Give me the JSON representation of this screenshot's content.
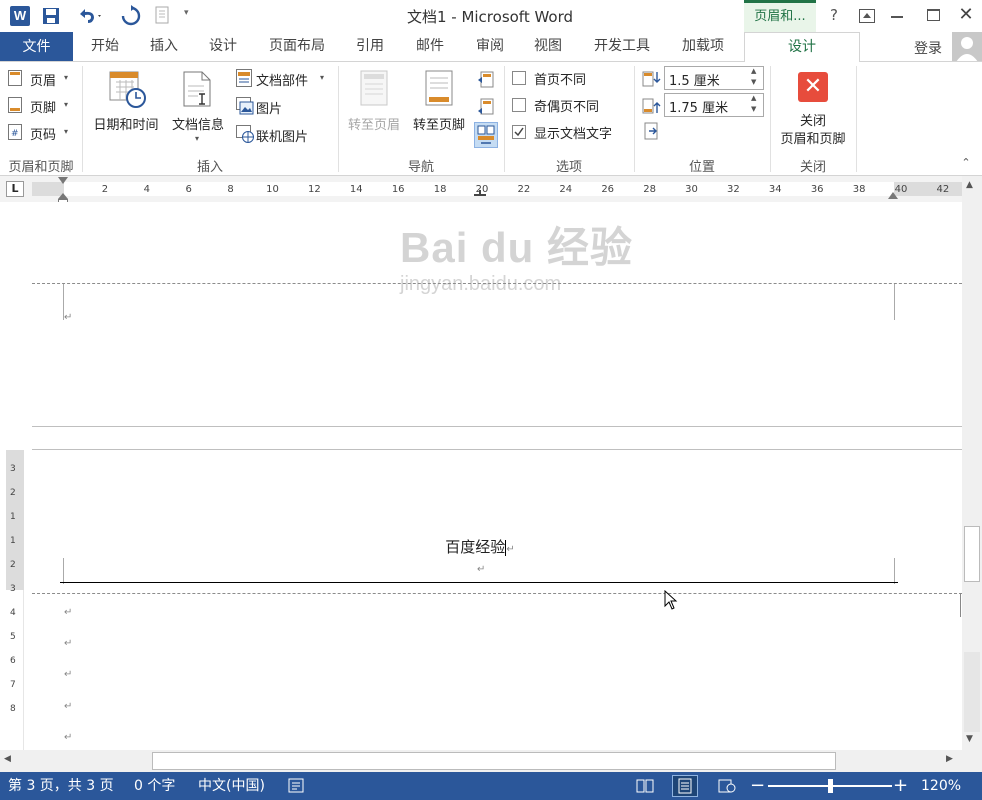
{
  "titlebar": {
    "title": "文档1 - Microsoft Word",
    "context_tab": "页眉和...",
    "help": "?",
    "word_icon": "word-logo",
    "save_icon": "save-icon",
    "undo_icon": "undo-icon",
    "redo_icon": "redo-icon",
    "customize_icon": "customize-qat-icon"
  },
  "tabs": {
    "file": "文件",
    "items": [
      "开始",
      "插入",
      "设计",
      "页面布局",
      "引用",
      "邮件",
      "审阅",
      "视图",
      "开发工具",
      "加载项"
    ],
    "active": "设计",
    "login": "登录"
  },
  "ribbon": {
    "hf_group": {
      "header": "页眉",
      "footer": "页脚",
      "page_number": "页码",
      "label": "页眉和页脚"
    },
    "insert_group": {
      "datetime": "日期和时间",
      "docinfo": "文档信息",
      "quickparts": "文档部件",
      "picture": "图片",
      "online_picture": "联机图片",
      "label": "插入"
    },
    "nav_group": {
      "goto_header": "转至页眉",
      "goto_footer": "转至页脚",
      "label": "导航"
    },
    "options_group": {
      "first_page": "首页不同",
      "odd_even": "奇偶页不同",
      "show_text": "显示文档文字",
      "first_page_checked": false,
      "odd_even_checked": false,
      "show_text_checked": true,
      "label": "选项"
    },
    "position_group": {
      "header_from_top": "1.5 厘米",
      "footer_from_bottom": "1.75 厘米",
      "label": "位置"
    },
    "close_group": {
      "close_line1": "关闭",
      "close_line2": "页眉和页脚",
      "label": "关闭"
    }
  },
  "ruler": {
    "corner": "L",
    "ticks": [
      "2",
      "4",
      "6",
      "8",
      "10",
      "12",
      "14",
      "16",
      "18",
      "20",
      "22",
      "24",
      "26",
      "28",
      "30",
      "32",
      "34",
      "36",
      "38",
      "40",
      "42"
    ],
    "vticks": [
      "3",
      "2",
      "1",
      "1",
      "2",
      "3",
      "4",
      "5",
      "6",
      "7",
      "8"
    ]
  },
  "document": {
    "header_text": "百度经验",
    "paragraph_mark": "↵",
    "watermark_main": "Bai du 经验",
    "watermark_sub": "jingyan.baidu.com"
  },
  "status": {
    "page": "第 3 页，共 3 页",
    "words": "0 个字",
    "language": "中文(中国)",
    "zoom": "120%",
    "zoom_minus": "−",
    "zoom_plus": "+",
    "zoom_fraction": 0.5
  },
  "colors": {
    "accent": "#2b579a",
    "context_tab": "#217346",
    "close_red": "#e74c3c"
  }
}
